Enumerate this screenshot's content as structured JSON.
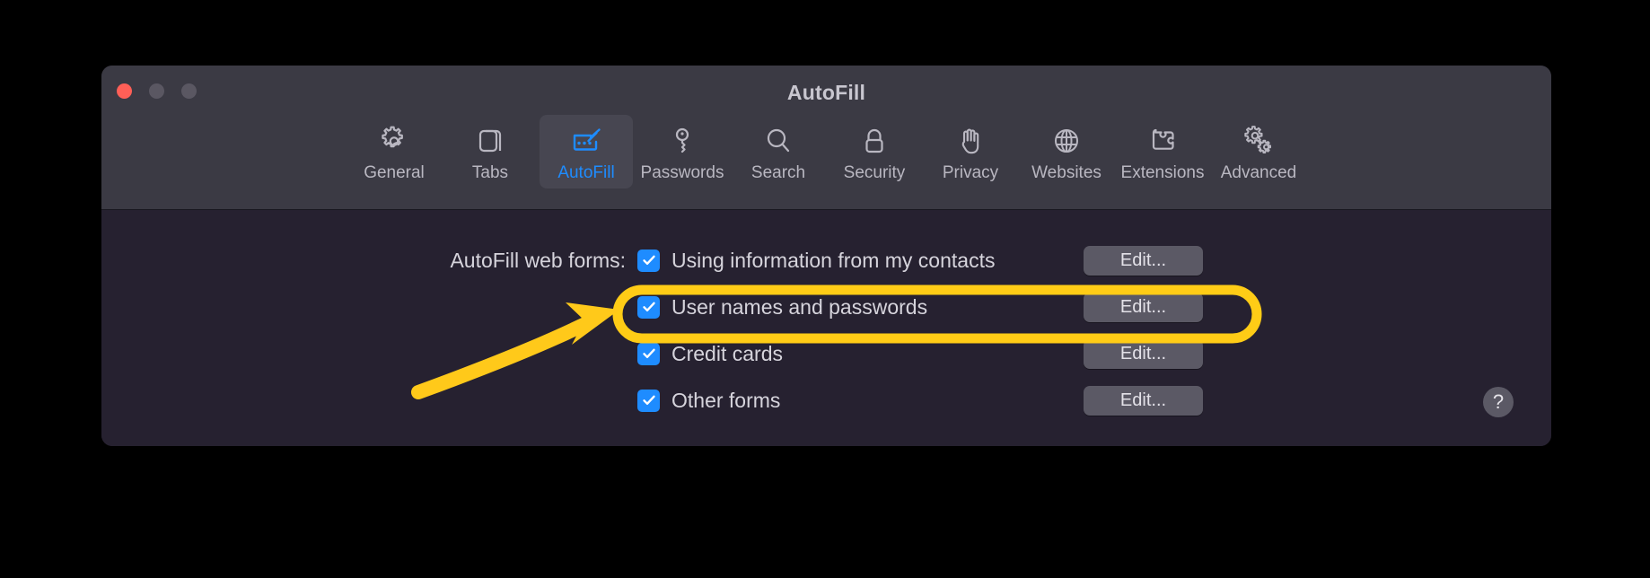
{
  "window": {
    "title": "AutoFill",
    "traffic_lights": [
      {
        "name": "close",
        "color": "#ff5f57"
      },
      {
        "name": "minimize",
        "color": "#5a5762"
      },
      {
        "name": "maximize",
        "color": "#5a5762"
      }
    ]
  },
  "toolbar": {
    "items": [
      {
        "label": "General",
        "icon": "gear-icon",
        "selected": false
      },
      {
        "label": "Tabs",
        "icon": "tabs-icon",
        "selected": false
      },
      {
        "label": "AutoFill",
        "icon": "autofill-icon",
        "selected": true
      },
      {
        "label": "Passwords",
        "icon": "key-icon",
        "selected": false
      },
      {
        "label": "Search",
        "icon": "magnifier-icon",
        "selected": false
      },
      {
        "label": "Security",
        "icon": "lock-icon",
        "selected": false
      },
      {
        "label": "Privacy",
        "icon": "hand-icon",
        "selected": false
      },
      {
        "label": "Websites",
        "icon": "globe-icon",
        "selected": false
      },
      {
        "label": "Extensions",
        "icon": "puzzle-icon",
        "selected": false
      },
      {
        "label": "Advanced",
        "icon": "gears-icon",
        "selected": false
      }
    ]
  },
  "content": {
    "section_label": "AutoFill web forms:",
    "rows": [
      {
        "label": "Using information from my contacts",
        "checked": true,
        "button": "Edit...",
        "highlighted": false
      },
      {
        "label": "User names and passwords",
        "checked": true,
        "button": "Edit...",
        "highlighted": true
      },
      {
        "label": "Credit cards",
        "checked": true,
        "button": "Edit...",
        "highlighted": false
      },
      {
        "label": "Other forms",
        "checked": true,
        "button": "Edit...",
        "highlighted": false
      }
    ],
    "help_button": "?"
  },
  "annotation": {
    "highlight_color": "#ffcc16",
    "arrow_color": "#ffc91a",
    "target_row": "User names and passwords"
  },
  "colors": {
    "accent": "#1e8cff",
    "window_bg": "#29242e",
    "toolbar_bg": "#3b3a44",
    "content_bg": "#262130",
    "button_bg": "#5b5965",
    "text": "#d6d4dc",
    "page_bg": "#000000"
  }
}
